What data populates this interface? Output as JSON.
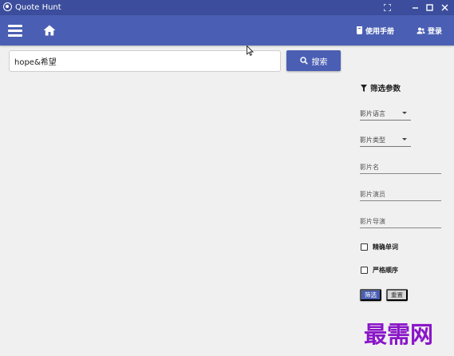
{
  "window": {
    "title": "Quote Hunt",
    "controls": [
      "fullscreen-icon",
      "minimize-icon",
      "maximize-icon",
      "close-icon"
    ]
  },
  "appbar": {
    "menu_icon": "hamburger-icon",
    "home_icon": "home-icon",
    "manual_label": "使用手册",
    "manual_icon": "book-icon",
    "login_label": "登录",
    "login_icon": "users-icon"
  },
  "search": {
    "value": "hope&希望",
    "button_label": "搜索",
    "button_icon": "search-icon"
  },
  "filters": {
    "title": "筛选参数",
    "title_icon": "filter-icon",
    "language_label": "影片语言",
    "type_label": "影片类型",
    "movie_name_placeholder": "影片名",
    "actor_placeholder": "影片演员",
    "director_placeholder": "影片导演",
    "exact_word_label": "精确单词",
    "strict_order_label": "严格顺序",
    "apply_label": "筛选",
    "reset_label": "重置"
  },
  "colors": {
    "titlebar": "#3b4d9c",
    "appbar": "#4a5fb3",
    "accent": "#4a5fb3",
    "background": "#f0f0f0",
    "watermark": "#8a16c8"
  },
  "watermark": "最需网"
}
